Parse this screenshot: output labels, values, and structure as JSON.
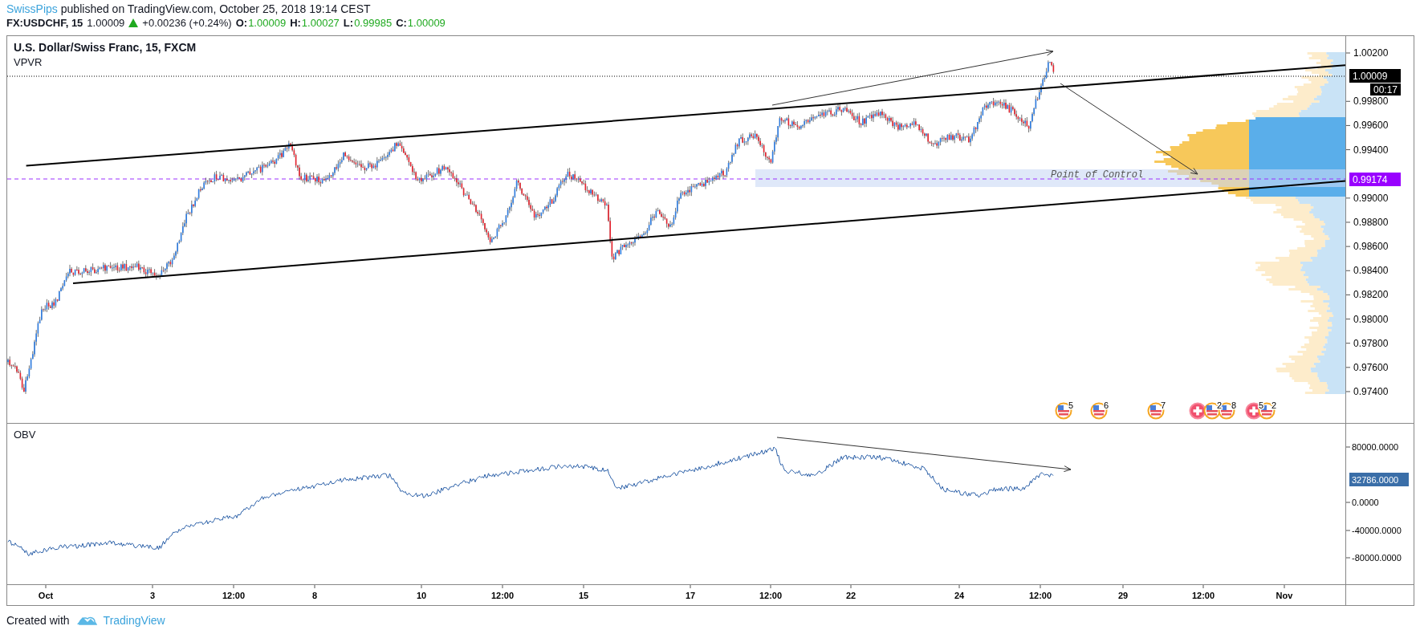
{
  "header": {
    "author": "SwissPips",
    "published": "published on TradingView.com, October 25, 2018 19:14 CEST"
  },
  "quote": {
    "symbol": "FX:USDCHF, 15",
    "last": "1.00009",
    "price_up": true,
    "change": "+0.00236 (+0.24%)",
    "ohlc": [
      {
        "key": "O:",
        "value": "1.00009"
      },
      {
        "key": "H:",
        "value": "1.00027"
      },
      {
        "key": "L:",
        "value": "0.99985"
      },
      {
        "key": "C:",
        "value": "1.00009"
      }
    ]
  },
  "price_pane": {
    "title": "U.S. Dollar/Swiss Franc, 15, FXCM",
    "indicator": "VPVR",
    "poc_label": "Point of Control",
    "last_price": "1.00009",
    "countdown": "00:17",
    "poc_price": "0.99174",
    "axis_ticks": [
      "1.00200",
      "0.99800",
      "0.99600",
      "0.99400",
      "0.99000",
      "0.98800",
      "0.98600",
      "0.98400",
      "0.98200",
      "0.98000",
      "0.97800",
      "0.97600",
      "0.97400"
    ],
    "events": [
      {
        "kind": "us",
        "label": "5"
      },
      {
        "kind": "us",
        "label": "6"
      },
      {
        "kind": "us",
        "label": "7"
      },
      {
        "kind": "ch"
      },
      {
        "kind": "us",
        "label": "2"
      },
      {
        "kind": "us",
        "label": "8"
      },
      {
        "kind": "ch",
        "label": "5"
      },
      {
        "kind": "us",
        "label": "2"
      }
    ]
  },
  "obv_pane": {
    "title": "OBV",
    "last_value": "32786.0000",
    "axis_ticks": [
      "80000.0000",
      "0.0000",
      "-40000.0000",
      "-80000.0000"
    ]
  },
  "time_axis": {
    "labels": [
      "Oct",
      "3",
      "12:00",
      "8",
      "10",
      "12:00",
      "15",
      "17",
      "12:00",
      "22",
      "24",
      "12:00",
      "29",
      "12:00",
      "Nov"
    ]
  },
  "footer": {
    "text": "Created with",
    "brand": "TradingView"
  }
}
